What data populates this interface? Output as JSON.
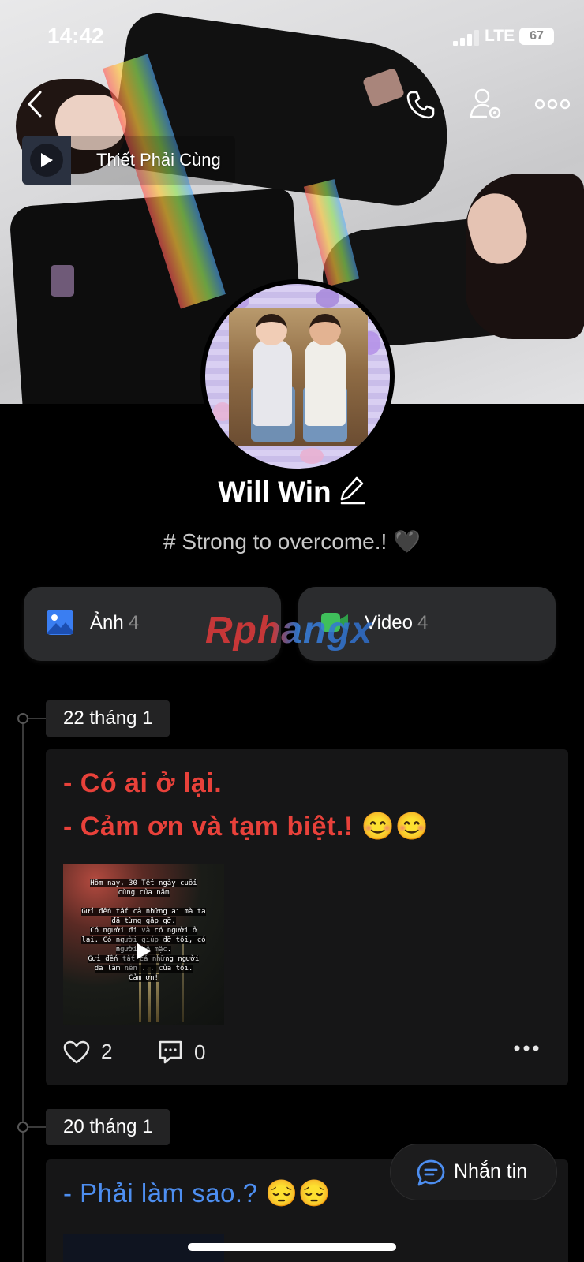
{
  "status_bar": {
    "time": "14:42",
    "network": "LTE",
    "battery": "67"
  },
  "music": {
    "title": "Thiết Phải Cùng"
  },
  "profile": {
    "name": "Will Win",
    "bio": "# Strong to overcome.! 🖤"
  },
  "media": {
    "photos": {
      "label": "Ảnh",
      "count": "4"
    },
    "videos": {
      "label": "Video",
      "count": "4"
    }
  },
  "watermark": "Rphangx",
  "posts": [
    {
      "date": "22 tháng 1",
      "lines": [
        "- Có ai ở lại.",
        "- Cảm ơn và tạm biệt.! 😊😊"
      ],
      "video_text": [
        "Hôm nay, 30 Tết ngày cuối",
        "cùng của năm",
        "",
        "Gửi đến tất cả những ai mà ta",
        "đã từng gặp gỡ.",
        "Có người đi và có người ở",
        "lại. Có người giúp đỡ tôi, có",
        "người bỏ mặc.",
        "Gửi đến tất cả những người",
        "đã làm nên ... của tôi.",
        "Cảm ơn!"
      ],
      "likes": "2",
      "comments": "0"
    },
    {
      "date": "20 tháng 1",
      "lines": [
        "- Phải làm sao.? 😔😔"
      ]
    }
  ],
  "message_button": {
    "label": "Nhắn tin"
  },
  "colors": {
    "accent_blue": "#4d8ef0",
    "post_red": "#e8413a",
    "background": "#000000"
  }
}
